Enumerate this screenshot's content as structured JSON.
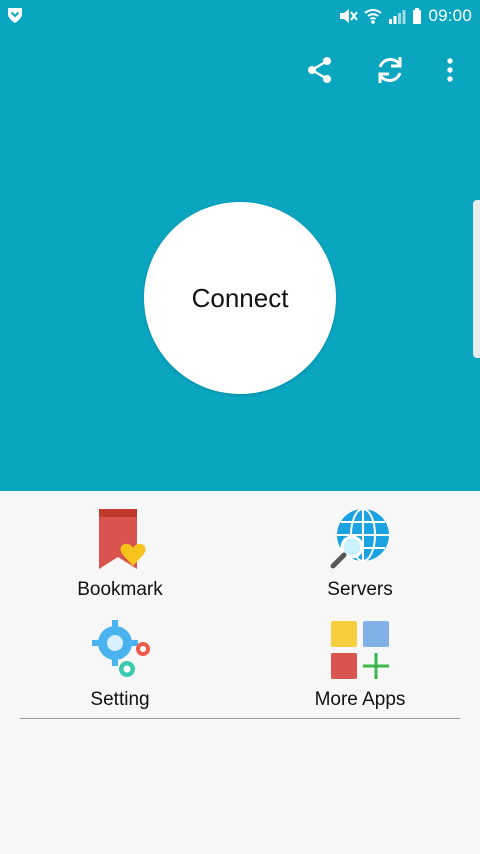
{
  "status_bar": {
    "time": "09:00",
    "icons": [
      "shield-icon",
      "mute-icon",
      "wifi-icon",
      "signal-icon",
      "battery-icon"
    ]
  },
  "toolbar": {
    "actions": [
      "share-icon",
      "refresh-icon",
      "overflow-menu-icon"
    ]
  },
  "main": {
    "connect_label": "Connect"
  },
  "menu": {
    "items": [
      {
        "label": "Bookmark",
        "icon": "bookmark-heart-icon"
      },
      {
        "label": "Servers",
        "icon": "globe-search-icon"
      },
      {
        "label": "Setting",
        "icon": "gears-icon"
      },
      {
        "label": "More Apps",
        "icon": "apps-grid-icon"
      }
    ]
  },
  "colors": {
    "primary": "#0aa5bf",
    "background": "#f7f7f7"
  }
}
